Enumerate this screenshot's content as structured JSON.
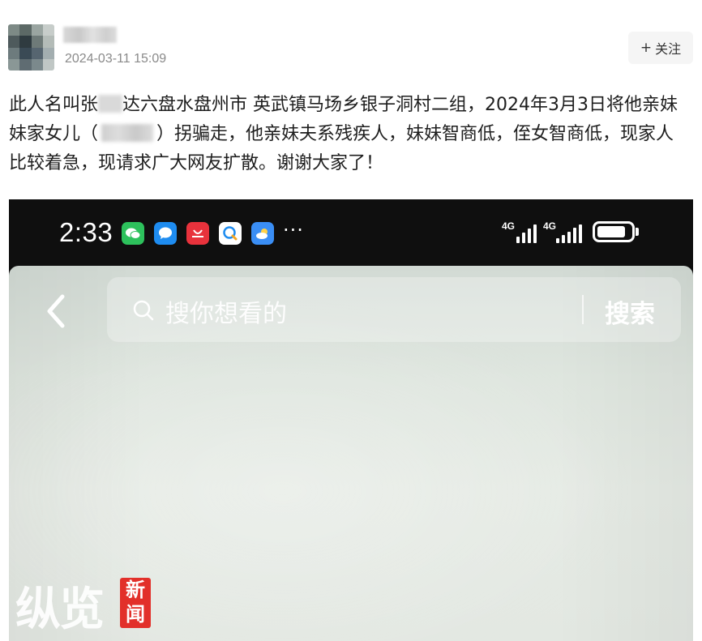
{
  "post": {
    "time": "2024-03-11 15:09",
    "follow_label": "关注",
    "text": {
      "line1_a": "此人名叫张",
      "line1_b": "达六盘水盘州市 英武镇马场乡银子洞村二组，2024年3月3日将他亲妹",
      "line2_a": "妹家女儿（",
      "line2_b": "）拐骗走，他亲妹夫系残疾人，妹妹智商低，侄女智商低，现家人",
      "line3": "比较着急，现请求广大网友扩散。谢谢大家了！"
    }
  },
  "video": {
    "status_bar": {
      "clock": "2:33",
      "more": "···",
      "sim1": "4G",
      "sim2": "4G",
      "app_icons": [
        "wechat-icon",
        "message-icon",
        "huawei-store-icon",
        "browser-icon",
        "weather-icon"
      ]
    },
    "search": {
      "placeholder": "搜你想看的",
      "button": "搜索"
    },
    "watermark": {
      "main": "纵览",
      "badge_top": "新",
      "badge_bottom": "闻"
    }
  },
  "colors": {
    "accent_red": "#e2302a",
    "wechat_green": "#2dc15c",
    "message_blue": "#1e8cf0",
    "huawei_red": "#e8323c",
    "weather_blue": "#3a8ef5"
  }
}
